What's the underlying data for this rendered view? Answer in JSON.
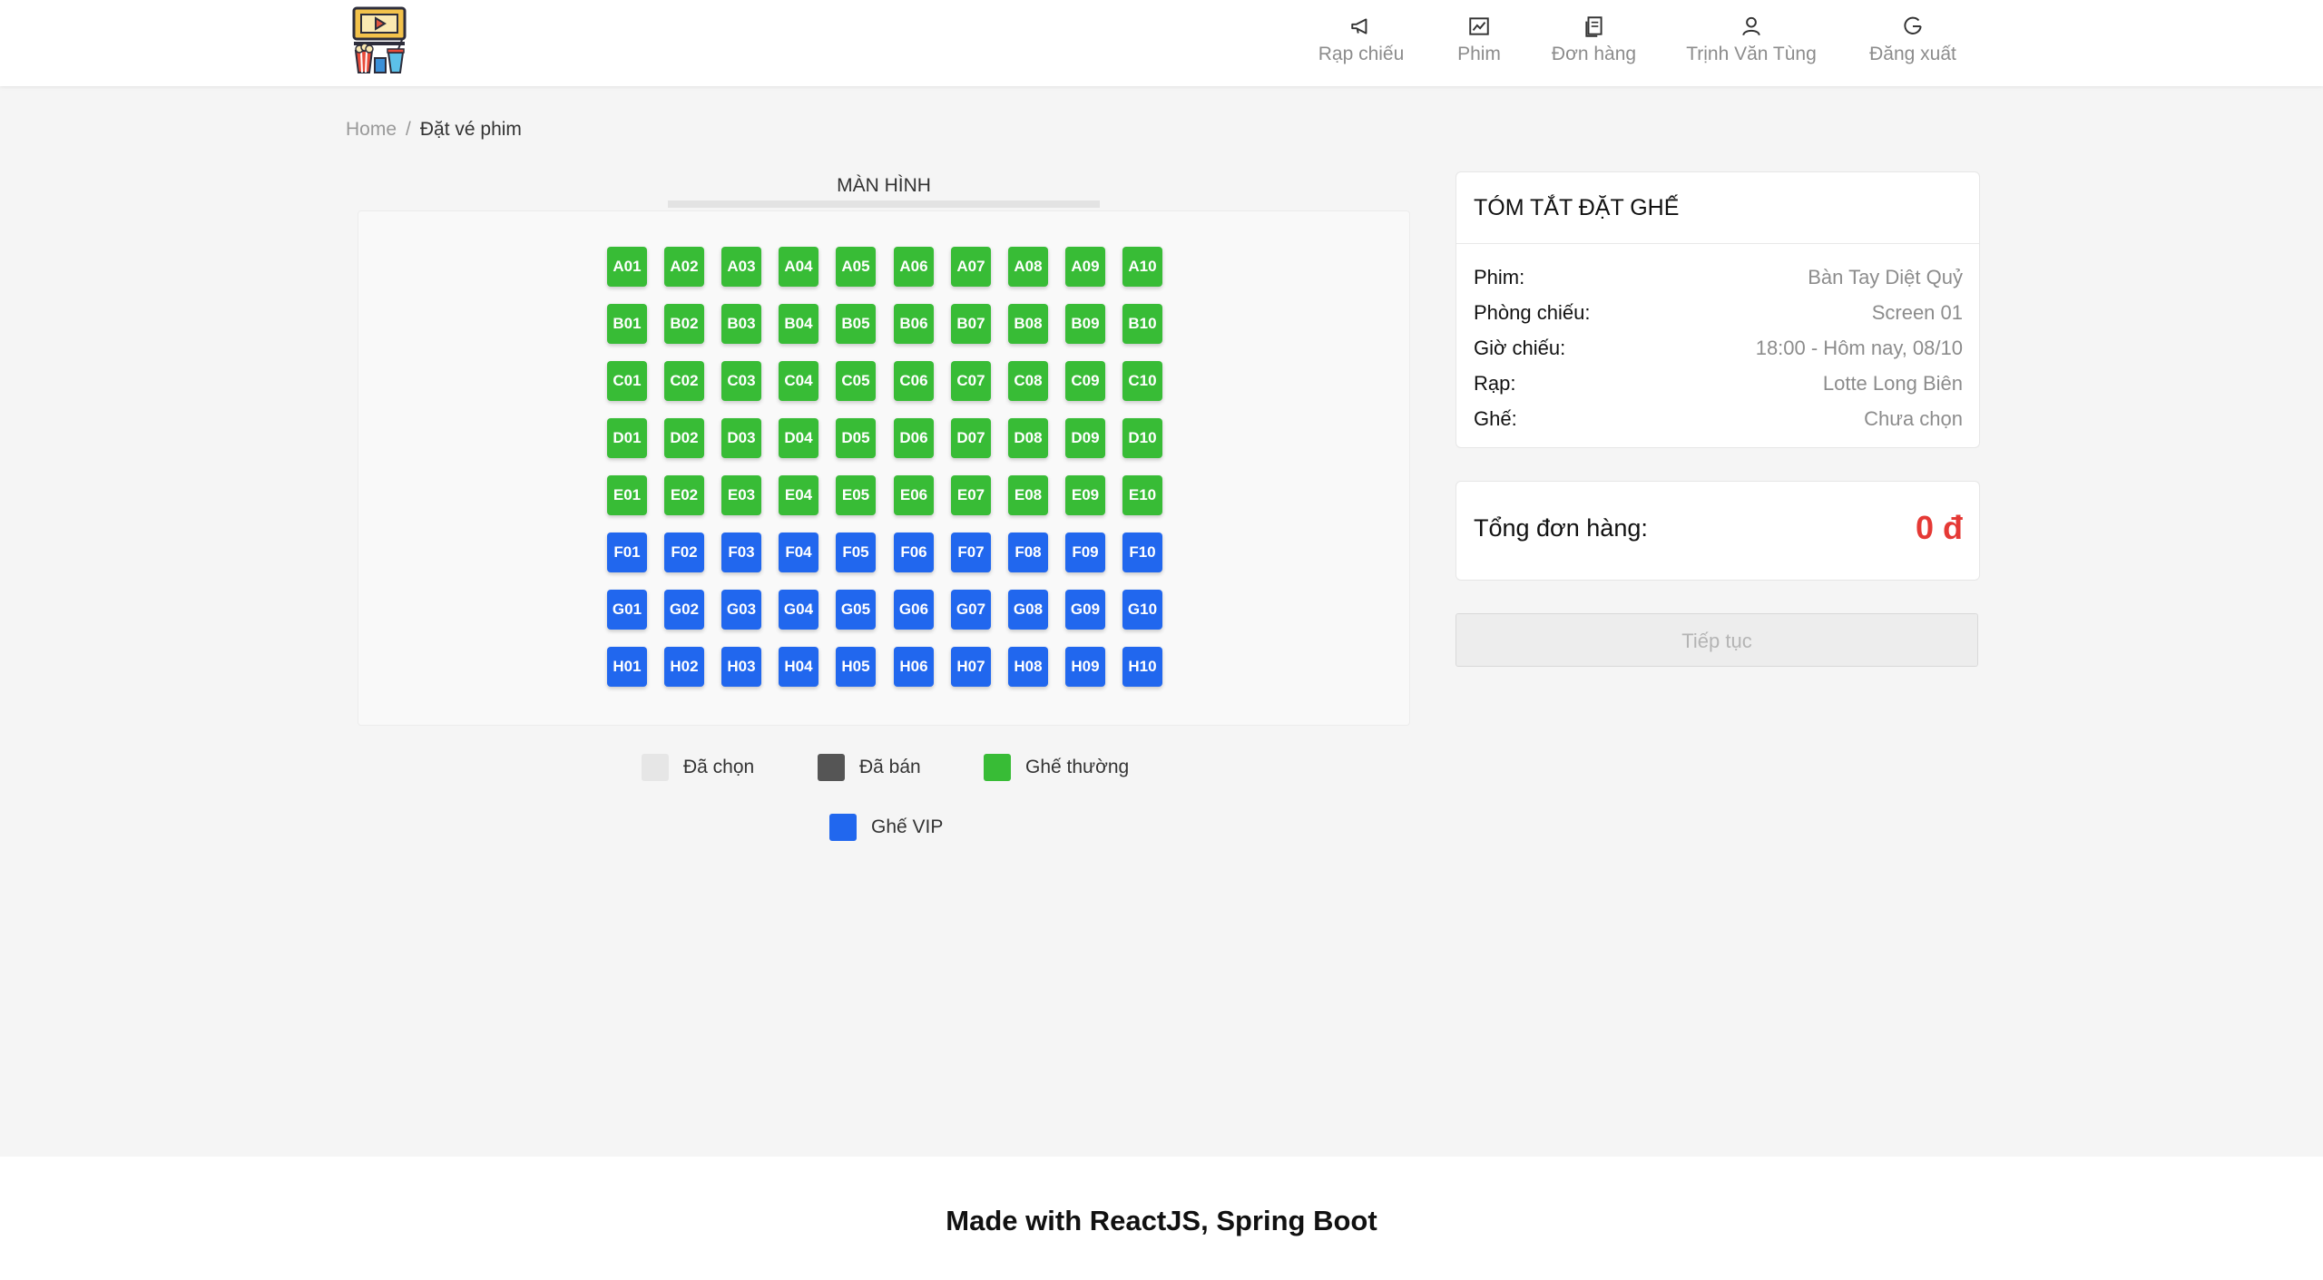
{
  "header": {
    "nav": [
      {
        "label": "Rạp chiếu",
        "icon": "megaphone-icon"
      },
      {
        "label": "Phim",
        "icon": "chart-icon"
      },
      {
        "label": "Đơn hàng",
        "icon": "document-icon"
      },
      {
        "label": "Trịnh Văn Tùng",
        "icon": "user-icon"
      },
      {
        "label": "Đăng xuất",
        "icon": "logout-icon"
      }
    ]
  },
  "breadcrumb": {
    "home": "Home",
    "separator": "/",
    "current": "Đặt vé phim"
  },
  "screen": {
    "label": "MÀN HÌNH"
  },
  "seats": {
    "rows": [
      {
        "seats": [
          "A01",
          "A02",
          "A03",
          "A04",
          "A05",
          "A06",
          "A07",
          "A08",
          "A09",
          "A10"
        ],
        "type": "normal"
      },
      {
        "seats": [
          "B01",
          "B02",
          "B03",
          "B04",
          "B05",
          "B06",
          "B07",
          "B08",
          "B09",
          "B10"
        ],
        "type": "normal"
      },
      {
        "seats": [
          "C01",
          "C02",
          "C03",
          "C04",
          "C05",
          "C06",
          "C07",
          "C08",
          "C09",
          "C10"
        ],
        "type": "normal"
      },
      {
        "seats": [
          "D01",
          "D02",
          "D03",
          "D04",
          "D05",
          "D06",
          "D07",
          "D08",
          "D09",
          "D10"
        ],
        "type": "normal"
      },
      {
        "seats": [
          "E01",
          "E02",
          "E03",
          "E04",
          "E05",
          "E06",
          "E07",
          "E08",
          "E09",
          "E10"
        ],
        "type": "normal"
      },
      {
        "seats": [
          "F01",
          "F02",
          "F03",
          "F04",
          "F05",
          "F06",
          "F07",
          "F08",
          "F09",
          "F10"
        ],
        "type": "vip"
      },
      {
        "seats": [
          "G01",
          "G02",
          "G03",
          "G04",
          "G05",
          "G06",
          "G07",
          "G08",
          "G09",
          "G10"
        ],
        "type": "vip"
      },
      {
        "seats": [
          "H01",
          "H02",
          "H03",
          "H04",
          "H05",
          "H06",
          "H07",
          "H08",
          "H09",
          "H10"
        ],
        "type": "vip"
      }
    ]
  },
  "legend": {
    "selected": {
      "label": "Đã chọn",
      "color": "#e6e6e6"
    },
    "sold": {
      "label": "Đã bán",
      "color": "#555555"
    },
    "normal": {
      "label": "Ghế thường",
      "color": "#38bc36"
    },
    "vip": {
      "label": "Ghế VIP",
      "color": "#2167ee"
    }
  },
  "summary": {
    "title": "TÓM TẮT ĐẶT GHẾ",
    "rows": [
      {
        "key": "Phim:",
        "value": "Bàn Tay Diệt Quỷ"
      },
      {
        "key": "Phòng chiếu:",
        "value": "Screen 01"
      },
      {
        "key": "Giờ chiếu:",
        "value": "18:00 - Hôm nay, 08/10"
      },
      {
        "key": "Rạp:",
        "value": "Lotte Long Biên"
      },
      {
        "key": "Ghế:",
        "value": "Chưa chọn"
      }
    ]
  },
  "total": {
    "label": "Tổng đơn hàng:",
    "value": "0 đ"
  },
  "continue_button": {
    "label": "Tiếp tục"
  },
  "footer": {
    "text": "Made with ReactJS, Spring Boot"
  }
}
